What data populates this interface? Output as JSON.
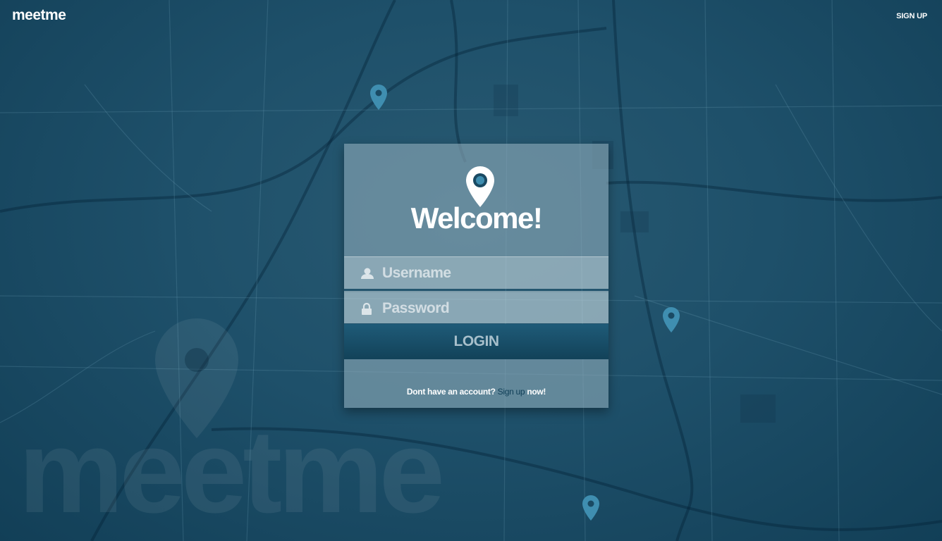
{
  "header": {
    "logo_text": "meetme",
    "signup_label": "SIGN UP"
  },
  "login_card": {
    "welcome_title": "Welcome!",
    "username_placeholder": "Username",
    "password_placeholder": "Password",
    "login_label": "LOGIN",
    "footer_prefix": "Dont have an account?",
    "footer_link": "Sign up",
    "footer_suffix": "now!"
  },
  "background": {
    "watermark_text": "meetme"
  },
  "icons": {
    "logo": "brand-wordmark",
    "card_pin": "map-pin-icon",
    "username": "user-icon",
    "password": "lock-icon"
  },
  "colors": {
    "background": "#1a4a63",
    "button": "#1a5270",
    "link": "#0f3e57"
  }
}
